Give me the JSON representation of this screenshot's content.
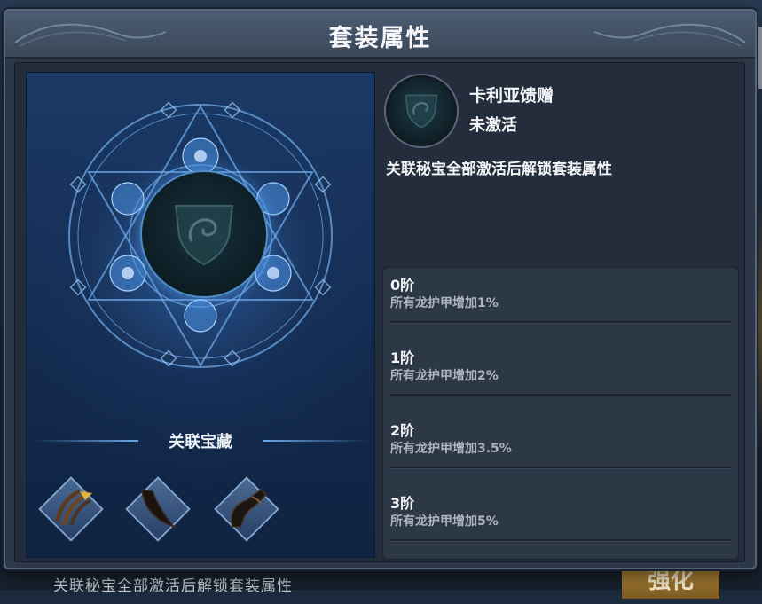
{
  "dialog": {
    "title": "套装属性"
  },
  "left_panel": {
    "related_title": "关联宝藏",
    "treasures": [
      {
        "icon": "claw-icon"
      },
      {
        "icon": "horn-icon"
      },
      {
        "icon": "curved-horn-icon"
      }
    ]
  },
  "set": {
    "name": "卡利亚馈赠",
    "status": "未激活",
    "description": "关联秘宝全部激活后解锁套装属性",
    "icon": "dragon-shield-icon"
  },
  "tiers": [
    {
      "name": "0阶",
      "effect": "所有龙护甲增加1%"
    },
    {
      "name": "1阶",
      "effect": "所有龙护甲增加2%"
    },
    {
      "name": "2阶",
      "effect": "所有龙护甲增加3.5%"
    },
    {
      "name": "3阶",
      "effect": "所有龙护甲增加5%"
    }
  ],
  "background": {
    "bottom_text": "关联秘宝全部激活后解锁套装属性",
    "right_button": "强化"
  },
  "colors": {
    "dialog_bg": "#2c3747",
    "accent_blue": "#4f8ec8",
    "text_primary": "#f3f5f8",
    "text_secondary": "#aeb5bf"
  }
}
